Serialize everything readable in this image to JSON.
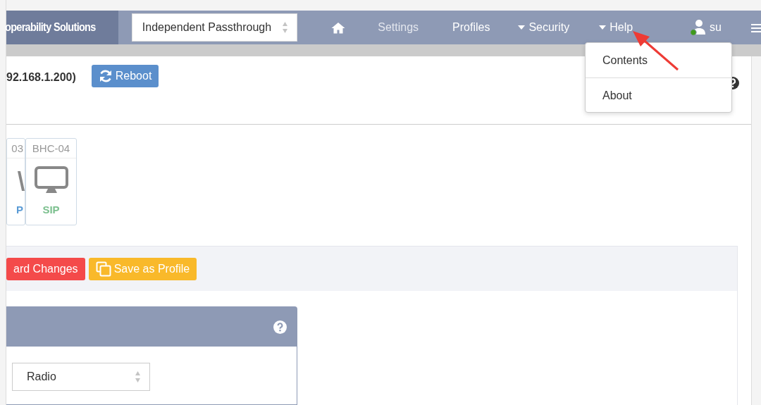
{
  "brand": "operability Solutions",
  "profile_select": {
    "value": "Independent Passthrough"
  },
  "nav_items": [
    {
      "kind": "home",
      "disabled": false,
      "dropdown": false
    },
    {
      "kind": "text",
      "label": "Settings",
      "disabled": true,
      "dropdown": false
    },
    {
      "kind": "text",
      "label": "Profiles",
      "disabled": false,
      "dropdown": false
    },
    {
      "kind": "text",
      "label": "Security",
      "disabled": false,
      "dropdown": true
    },
    {
      "kind": "text",
      "label": "Help",
      "disabled": false,
      "dropdown": true
    }
  ],
  "user": {
    "name": "su",
    "online": true
  },
  "help_menu": [
    "Contents",
    "About"
  ],
  "device": {
    "title": "92.168.1.200)",
    "button": "Reboot"
  },
  "tiles": [
    {
      "kind": "antenna",
      "name": "03",
      "type": "P",
      "color": "#5a9bd5"
    },
    {
      "kind": "monitor",
      "name": "BHC-04",
      "type": "SIP",
      "color": "#7cc08f"
    }
  ],
  "actions": [
    {
      "kind": "danger",
      "label": "ard Changes"
    },
    {
      "kind": "warning",
      "label": "Save as Profile"
    }
  ],
  "panel": {
    "select_value": "Radio"
  }
}
